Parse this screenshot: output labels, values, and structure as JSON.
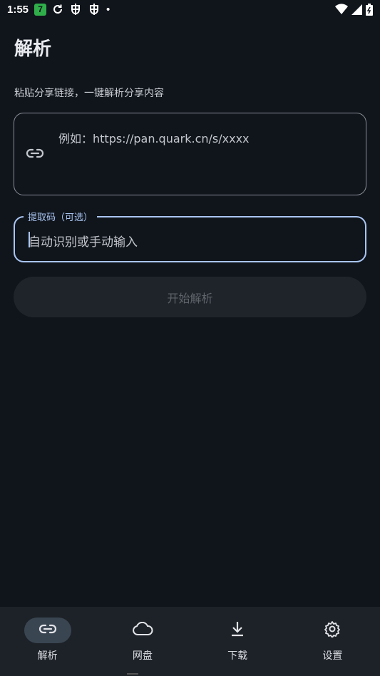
{
  "status_bar": {
    "time": "1:55",
    "notification_badge": "7",
    "dot": "•"
  },
  "header": {
    "title": "解析"
  },
  "description": "粘贴分享链接，一键解析分享内容",
  "link_input": {
    "placeholder": "例如：https://pan.quark.cn/s/xxxx"
  },
  "code_input": {
    "label": "提取码（可选）",
    "placeholder": "自动识别或手动输入"
  },
  "start_button": {
    "label": "开始解析"
  },
  "bottom_nav": {
    "items": [
      {
        "label": "解析",
        "icon": "link-icon",
        "active": true
      },
      {
        "label": "网盘",
        "icon": "cloud-icon",
        "active": false
      },
      {
        "label": "下载",
        "icon": "download-icon",
        "active": false
      },
      {
        "label": "设置",
        "icon": "gear-icon",
        "active": false
      }
    ]
  },
  "colors": {
    "background": "#10151c",
    "accent": "#a9c5f2",
    "nav_background": "#1d2228",
    "active_pill": "#3a4552"
  }
}
